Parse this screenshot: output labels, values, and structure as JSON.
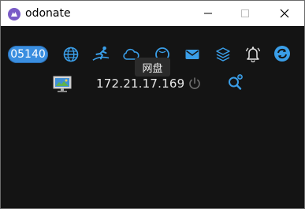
{
  "window": {
    "title": "odonate",
    "minimize_label": "minimize",
    "maximize_label": "maximize",
    "close_label": "close"
  },
  "toolbar": {
    "id_badge": "05140",
    "items": [
      {
        "name": "globe-icon"
      },
      {
        "name": "runner-icon"
      },
      {
        "name": "cloud-icon"
      },
      {
        "name": "sphere-icon"
      },
      {
        "name": "mail-icon"
      },
      {
        "name": "layers-icon"
      },
      {
        "name": "bell-icon"
      },
      {
        "name": "sync-icon"
      }
    ],
    "tooltip": "网盘"
  },
  "device": {
    "ip": "172.21.17.169",
    "icon": "monitor-icon",
    "power_icon": "power-icon",
    "search_icon": "search-settings-icon"
  },
  "colors": {
    "accent": "#3a9ee8",
    "background": "#141414"
  }
}
